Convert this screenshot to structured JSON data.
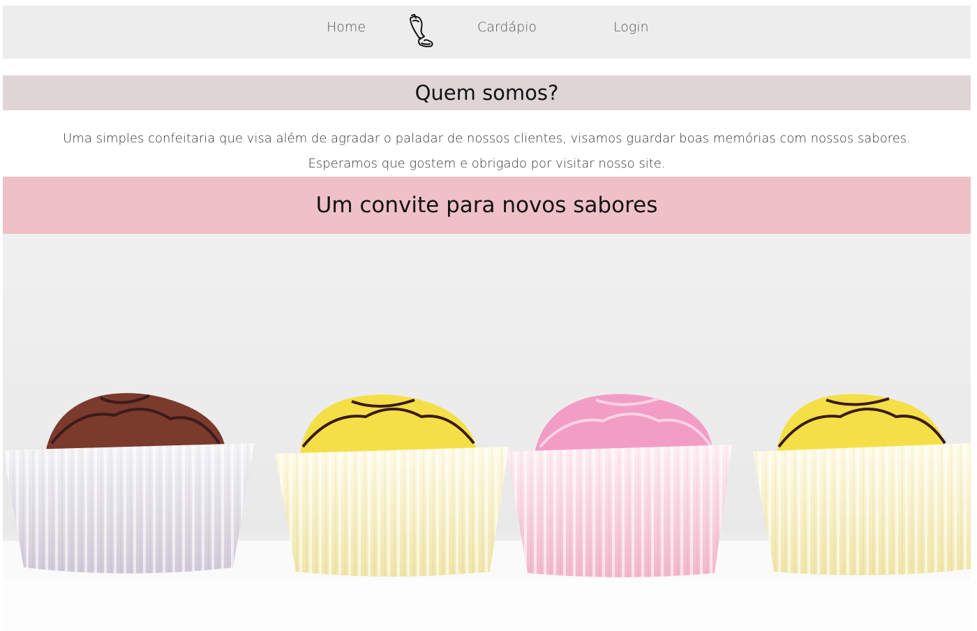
{
  "nav": {
    "home_label": "Home",
    "menu_label": "Cardápio",
    "login_label": "Login",
    "logo_icon": "piping-bag-icon"
  },
  "about": {
    "title": "Quem somos?",
    "line1": "Uma simples confeitaria que visa além de agradar o paladar de nossos clientes, visamos guardar boas memórias com nossos sabores.",
    "line2": "Esperamos que gostem e obrigado por visitar nosso site."
  },
  "invite": {
    "title": "Um convite para novos sabores"
  },
  "hero": {
    "image_icon": "cupcakes-photo",
    "colors": {
      "chocolate": "#7a3a2c",
      "yellow": "#f4e046",
      "pink": "#f29dc6",
      "drizzle": "#3b1b1b"
    }
  },
  "colors": {
    "navbar_bg": "#ededed",
    "about_header_bg": "#dfd5d6",
    "invite_header_bg": "#efc0c6"
  }
}
